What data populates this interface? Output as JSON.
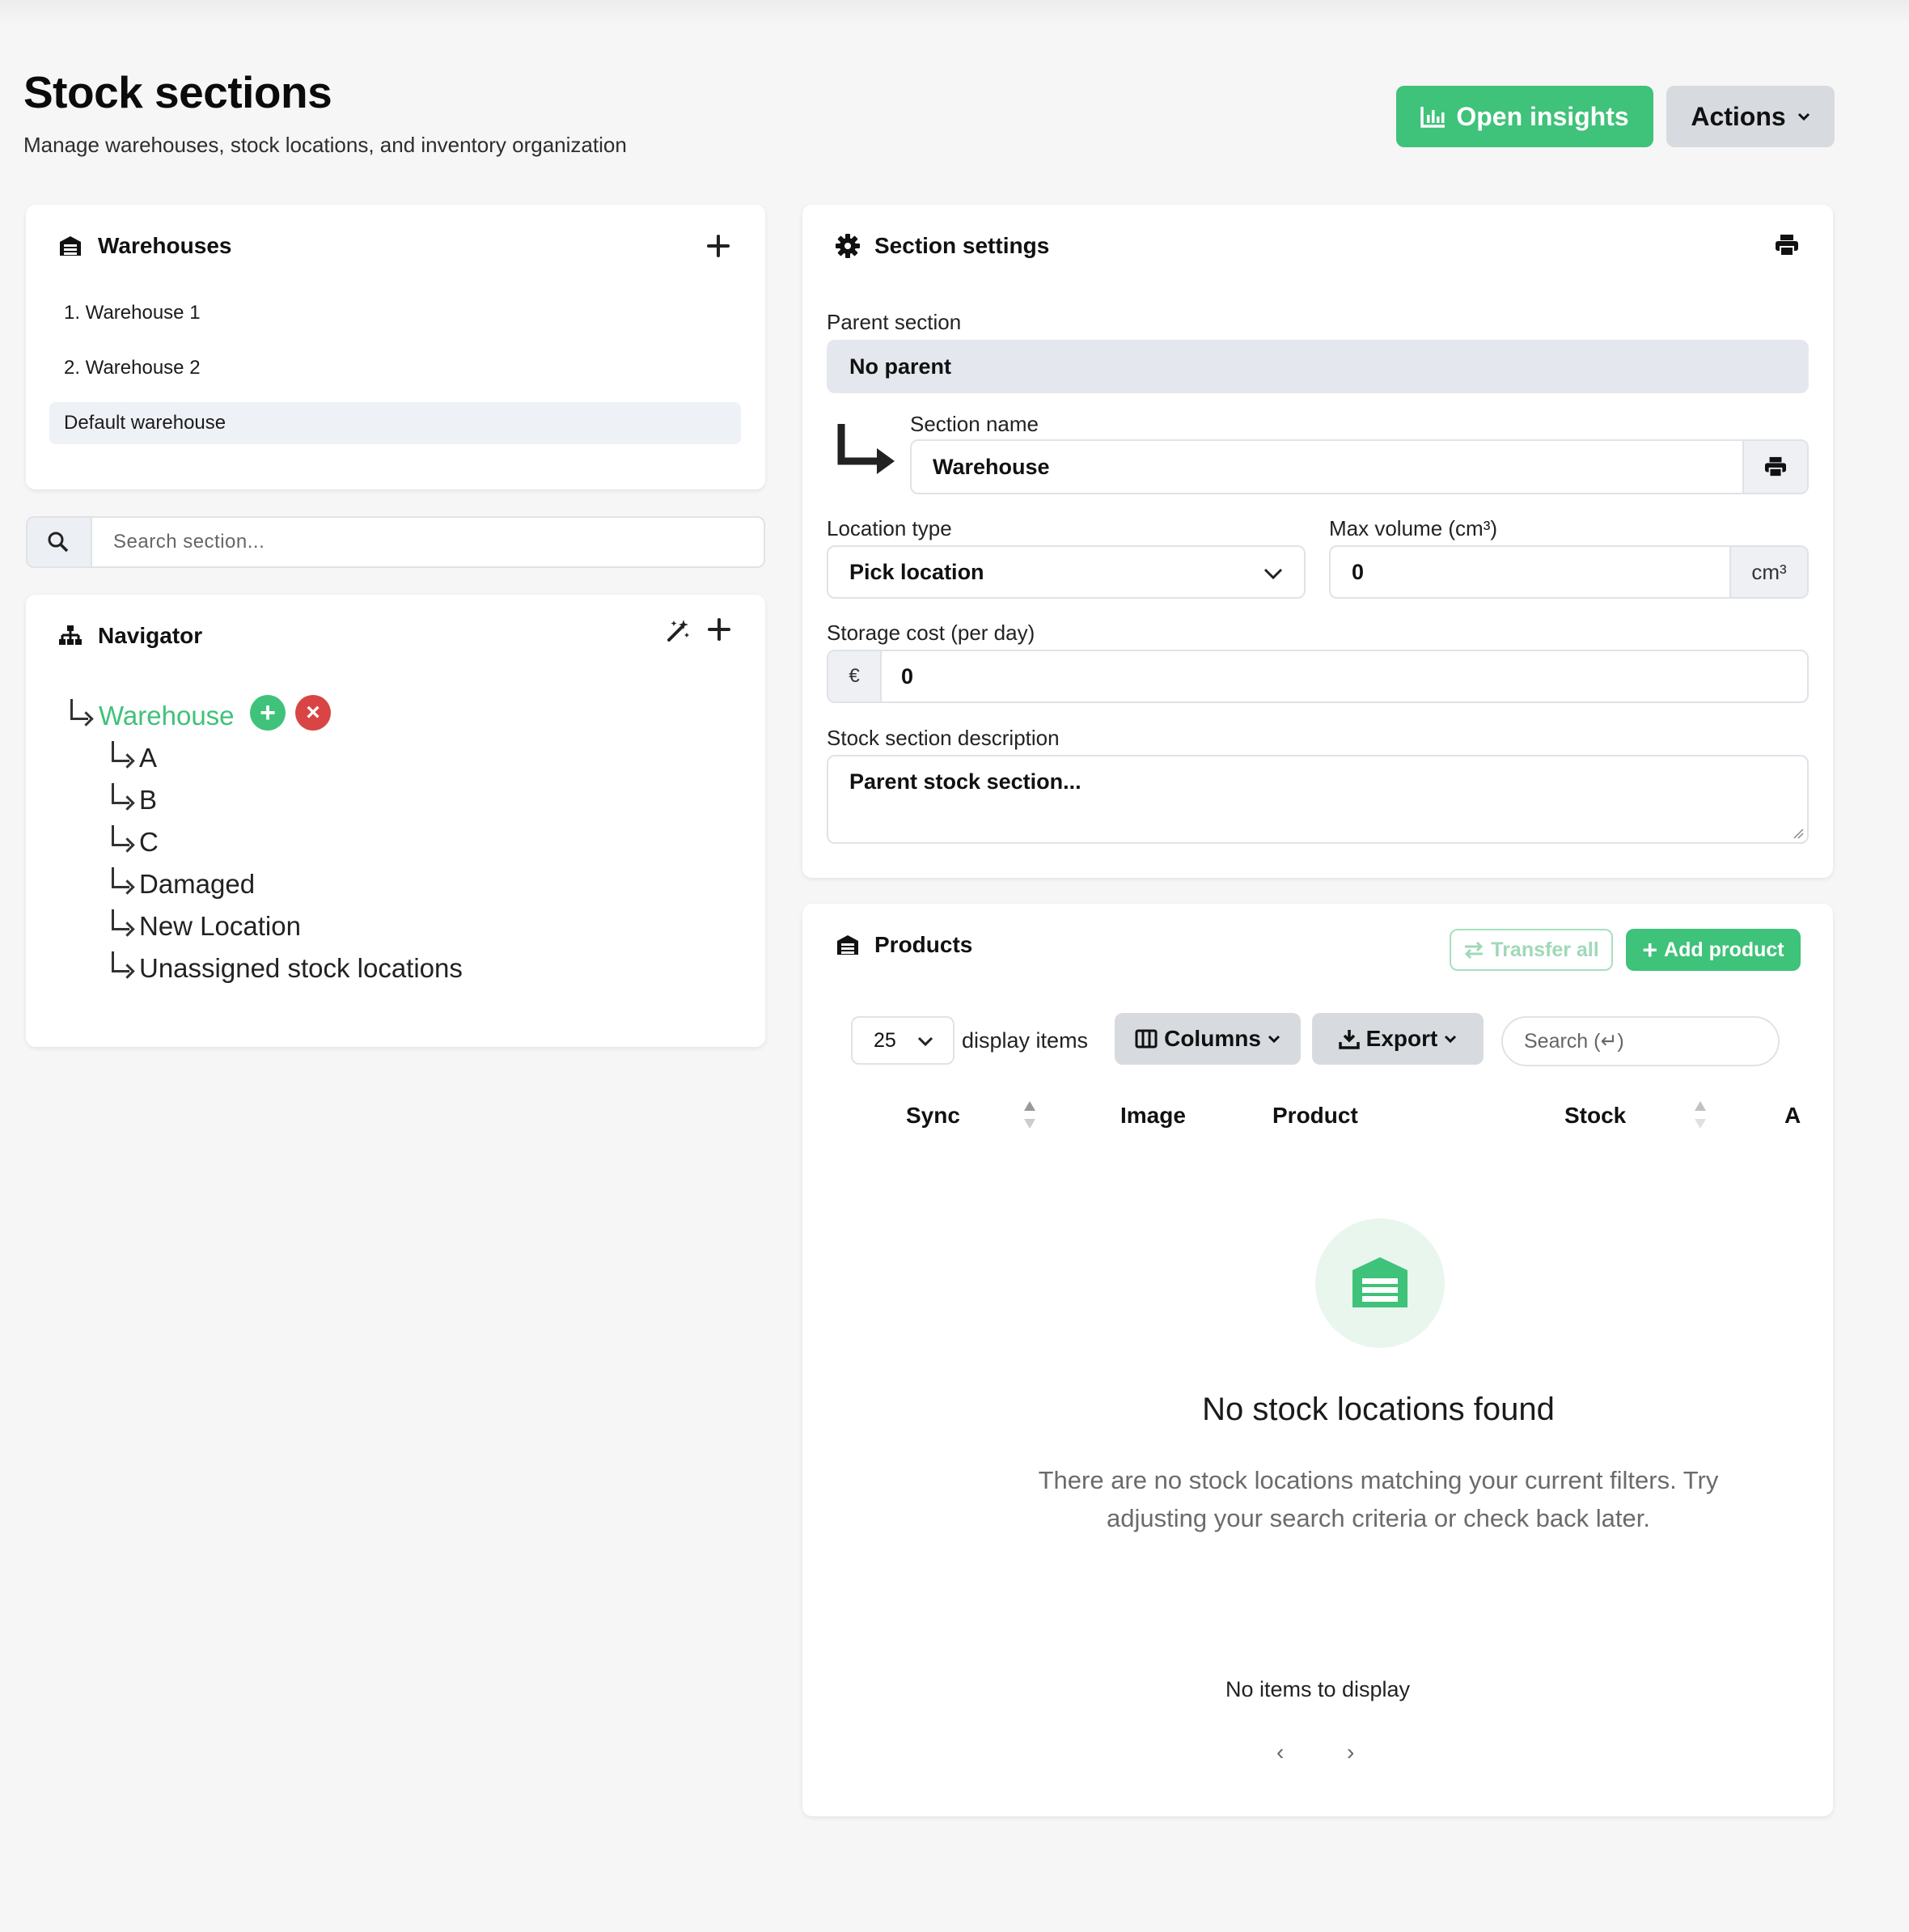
{
  "header": {
    "title": "Stock sections",
    "subtitle": "Manage warehouses, stock locations, and inventory organization",
    "insights_label": "Open insights",
    "actions_label": "Actions"
  },
  "warehouses": {
    "title": "Warehouses",
    "items": [
      {
        "label": "1. Warehouse 1"
      },
      {
        "label": "2. Warehouse 2"
      },
      {
        "label": "Default warehouse",
        "active": true
      }
    ]
  },
  "section_search": {
    "placeholder": "Search section..."
  },
  "navigator": {
    "title": "Navigator",
    "root": "Warehouse",
    "children": [
      "A",
      "B",
      "C",
      "Damaged",
      "New Location",
      "Unassigned stock locations"
    ]
  },
  "settings": {
    "title": "Section settings",
    "parent_label": "Parent section",
    "parent_value": "No parent",
    "name_label": "Section name",
    "name_value": "Warehouse",
    "location_type_label": "Location type",
    "location_type_value": "Pick location",
    "max_volume_label": "Max volume (cm³)",
    "max_volume_value": "0",
    "max_volume_unit": "cm³",
    "storage_cost_label": "Storage cost (per day)",
    "storage_cost_currency": "€",
    "storage_cost_value": "0",
    "description_label": "Stock section description",
    "description_value": "Parent stock section..."
  },
  "products": {
    "title": "Products",
    "transfer_label": "Transfer all",
    "add_label": "Add product",
    "page_size": "25",
    "display_items_label": "display items",
    "columns_label": "Columns",
    "export_label": "Export",
    "search_placeholder": "Search (↵)",
    "columns": [
      "Sync",
      "Image",
      "Product",
      "Stock",
      "A"
    ],
    "empty_title": "No stock locations found",
    "empty_text": "There are no stock locations matching your current filters. Try adjusting your search criteria or check back later.",
    "no_items": "No items to display",
    "prev": "‹",
    "next": "›"
  },
  "colors": {
    "accent_green": "#3fc27a",
    "danger_red": "#d94444",
    "page_bg": "#f6f6f6"
  }
}
